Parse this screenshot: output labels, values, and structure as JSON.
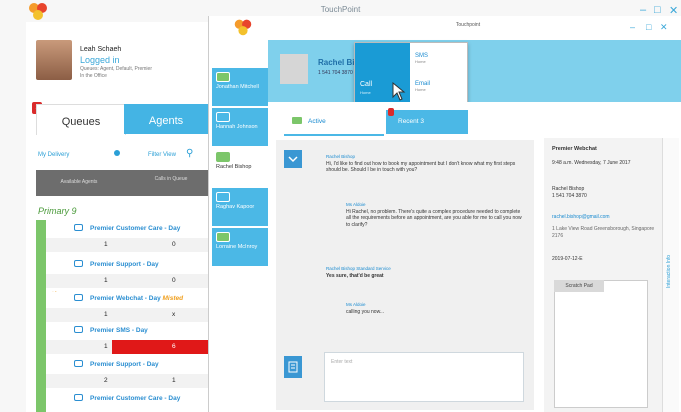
{
  "main_window": {
    "title": "TouchPoint"
  },
  "user": {
    "name": "Leah Schaeh",
    "status": "Logged in",
    "sub": "Queues: Agent, Default, Premier",
    "location": "In the Office"
  },
  "queue_alert_count": "1",
  "tabs": {
    "queues": "Queues",
    "agents": "Agents"
  },
  "filters": {
    "my_delivery": "My Delivery",
    "filter_view": "Filter View"
  },
  "table_headers": {
    "available_agents": "Available Agents",
    "calls_in_queue": "Calls in Queue"
  },
  "primary_label": "Primary",
  "primary_count": "9",
  "queues": [
    {
      "name": "Premier Customer Care - Day",
      "agents": "1",
      "calls": "0",
      "icon": "phone"
    },
    {
      "name": "Premier Support - Day",
      "agents": "1",
      "calls": "0",
      "icon": "phone"
    },
    {
      "name": "Premier Webchat - Day",
      "agents": "1",
      "calls": "x",
      "icon": "chat",
      "extra": "Misted"
    },
    {
      "name": "Premier SMS - Day",
      "agents": "1",
      "calls": "6",
      "icon": "chat",
      "alert": true
    },
    {
      "name": "Premier Support - Day",
      "agents": "2",
      "calls": "1",
      "icon": "email"
    },
    {
      "name": "Premier Customer Care - Day",
      "agents": "",
      "calls": "",
      "icon": "email"
    }
  ],
  "agents": [
    {
      "name": "Jonathan Mitchell",
      "style": "blue"
    },
    {
      "name": "Hannah Johnson",
      "style": "blue"
    },
    {
      "name": "Rachel Bishop",
      "style": "white"
    },
    {
      "name": "Raghav Kapoor",
      "style": "blue"
    },
    {
      "name": "Lorraine McInroy",
      "style": "blue"
    }
  ],
  "chat_window": {
    "title": "Touchpoint"
  },
  "contact": {
    "name": "Rachel Bishop",
    "phone": "1 541 704 3870"
  },
  "contact_menu": {
    "call": {
      "label": "Call",
      "sub": "Home"
    },
    "sms": {
      "label": "SMS",
      "sub": "Home"
    },
    "email": {
      "label": "Email",
      "sub": "Home"
    }
  },
  "chat_tabs": {
    "active": "Active",
    "recent": "Recent 3"
  },
  "messages": [
    {
      "who": "Rachel Bishop",
      "text": "Hi, I'd like to find out how to book my appointment but I don't know what my first steps should be. Should I be in touch with you?"
    },
    {
      "who": "Ms Aldoie",
      "text": "Hi Rachel, no problem. There's quite a complex procedure needed to complete all the requirements before an appointment, are you able for me to call you now to clarify?"
    },
    {
      "who": "Rachel Bishop Standard Service",
      "text": "Yes sure, that'd be great"
    },
    {
      "who": "Ms Aldoie",
      "text": "calling you now..."
    }
  ],
  "compose_placeholder": "Enter text",
  "info": {
    "queue": "Premier Webchat",
    "time": "9:48 a.m. Wednesday, 7 June 2017",
    "customer": "Rachel Bishop",
    "customer_phone": "1 541 704 3870",
    "email": "rachel.bishop@gmail.com",
    "address": "1 Lake View Road Greensborough, Singapore 2176",
    "extra": "2019-07-12-E",
    "panel_label": "Interaction Info",
    "scratch_pad": "Scratch Pad"
  }
}
